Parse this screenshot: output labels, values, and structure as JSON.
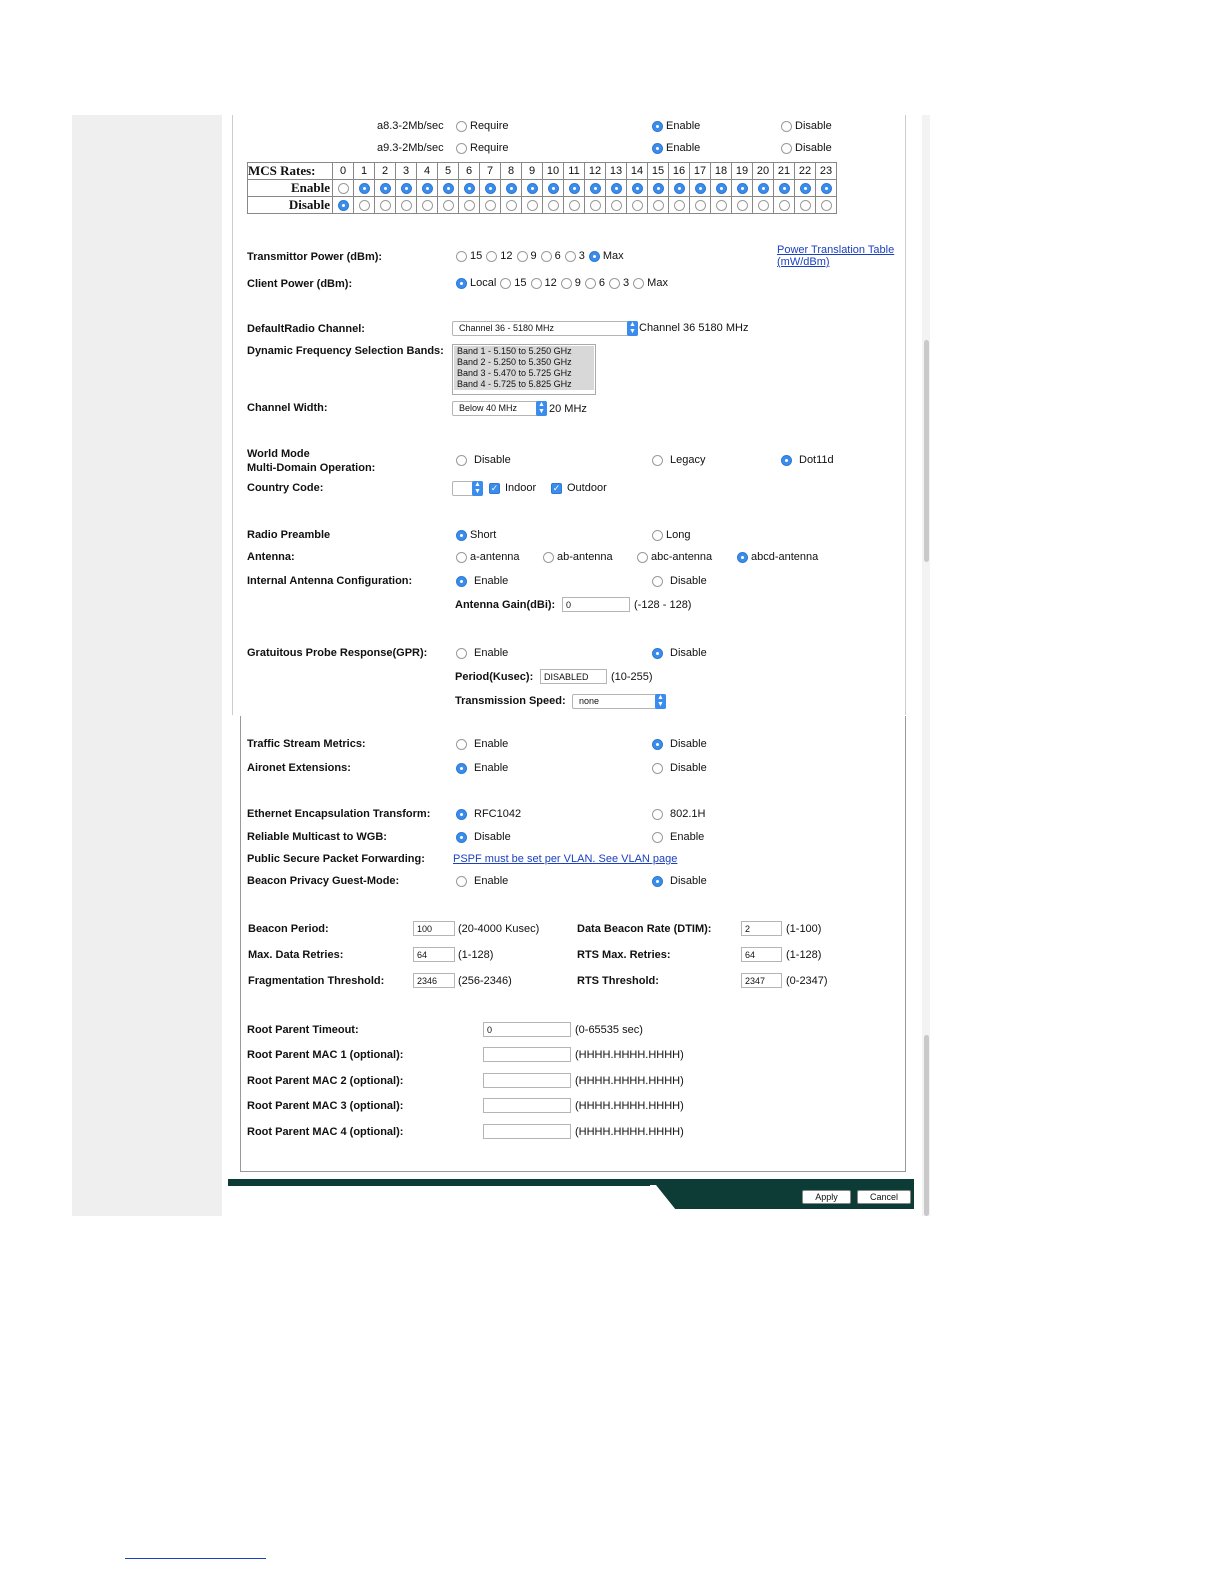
{
  "basic_rates": [
    {
      "rate": "a8.3-2Mb/sec",
      "options": [
        "Require",
        "Enable",
        "Disable"
      ],
      "selected": "Enable"
    },
    {
      "rate": "a9.3-2Mb/sec",
      "options": [
        "Require",
        "Enable",
        "Disable"
      ],
      "selected": "Enable"
    }
  ],
  "mcs": {
    "title": "MCS Rates:",
    "enable_label": "Enable",
    "disable_label": "Disable",
    "indices": [
      "0",
      "1",
      "2",
      "3",
      "4",
      "5",
      "6",
      "7",
      "8",
      "9",
      "10",
      "11",
      "12",
      "13",
      "14",
      "15",
      "16",
      "17",
      "18",
      "19",
      "20",
      "21",
      "22",
      "23"
    ],
    "enabled": [
      false,
      true,
      true,
      true,
      true,
      true,
      true,
      true,
      true,
      true,
      true,
      true,
      true,
      true,
      true,
      true,
      true,
      true,
      true,
      true,
      true,
      true,
      true,
      true
    ]
  },
  "tx_power": {
    "label": "Transmittor Power (dBm):",
    "options": [
      "15",
      "12",
      "9",
      "6",
      "3",
      "Max"
    ],
    "selected": "Max",
    "link_line1": "Power Translation Table",
    "link_line2": "(mW/dBm)"
  },
  "client_power": {
    "label": "Client Power (dBm):",
    "options": [
      "Local",
      "15",
      "12",
      "9",
      "6",
      "3",
      "Max"
    ],
    "selected": "Local"
  },
  "default_channel": {
    "label": "DefaultRadio Channel:",
    "value": "Channel 36 - 5180 MHz",
    "current": "Channel 36 5180 MHz"
  },
  "dfs": {
    "label": "Dynamic Frequency Selection Bands:",
    "bands": [
      "Band 1 - 5.150 to 5.250 GHz",
      "Band 2 - 5.250 to 5.350 GHz",
      "Band 3 - 5.470 to 5.725 GHz",
      "Band 4 - 5.725 to 5.825 GHz"
    ]
  },
  "channel_width": {
    "label": "Channel Width:",
    "value": "Below 40 MHz",
    "current": "20 MHz"
  },
  "world_mode": {
    "label_line1": "World Mode",
    "label_line2": "Multi-Domain Operation:",
    "options": [
      "Disable",
      "Legacy",
      "Dot11d"
    ],
    "selected": "Dot11d"
  },
  "country_code": {
    "label": "Country Code:",
    "indoor": "Indoor",
    "outdoor": "Outdoor"
  },
  "preamble": {
    "label": "Radio Preamble",
    "options": [
      "Short",
      "Long"
    ],
    "selected": "Short"
  },
  "antenna": {
    "label": "Antenna:",
    "options": [
      "a-antenna",
      "ab-antenna",
      "abc-antenna",
      "abcd-antenna"
    ],
    "selected": "abcd-antenna"
  },
  "internal_antenna": {
    "label": "Internal Antenna Configuration:",
    "options": [
      "Enable",
      "Disable"
    ],
    "selected": "Enable",
    "gain_label": "Antenna Gain(dBi):",
    "gain_value": "0",
    "gain_range": "(-128 - 128)"
  },
  "gpr": {
    "label": "Gratuitous Probe Response(GPR):",
    "options": [
      "Enable",
      "Disable"
    ],
    "selected": "Disable",
    "period_label": "Period(Kusec):",
    "period_value": "DISABLED",
    "period_range": "(10-255)",
    "speed_label": "Transmission Speed:",
    "speed_value": "none"
  },
  "traffic_stream": {
    "label": "Traffic Stream Metrics:",
    "options": [
      "Enable",
      "Disable"
    ],
    "selected": "Disable"
  },
  "aironet": {
    "label": "Aironet Extensions:",
    "options": [
      "Enable",
      "Disable"
    ],
    "selected": "Enable"
  },
  "ethernet_encap": {
    "label": "Ethernet Encapsulation Transform:",
    "options": [
      "RFC1042",
      "802.1H"
    ],
    "selected": "RFC1042"
  },
  "reliable_multicast": {
    "label": "Reliable Multicast to WGB:",
    "options": [
      "Disable",
      "Enable"
    ],
    "selected": "Disable"
  },
  "pspf": {
    "label": "Public Secure Packet Forwarding:",
    "link": "PSPF must be set per VLAN. See VLAN page"
  },
  "beacon_privacy": {
    "label": "Beacon Privacy Guest-Mode:",
    "options": [
      "Enable",
      "Disable"
    ],
    "selected": "Disable"
  },
  "timing": {
    "beacon_period": {
      "label": "Beacon Period:",
      "value": "100",
      "range": "(20-4000 Kusec)"
    },
    "dtim": {
      "label": "Data Beacon Rate (DTIM):",
      "value": "2",
      "range": "(1-100)"
    },
    "max_data_retries": {
      "label": "Max. Data Retries:",
      "value": "64",
      "range": "(1-128)"
    },
    "rts_max_retries": {
      "label": "RTS Max. Retries:",
      "value": "64",
      "range": "(1-128)"
    },
    "frag_threshold": {
      "label": "Fragmentation Threshold:",
      "value": "2346",
      "range": "(256-2346)"
    },
    "rts_threshold": {
      "label": "RTS Threshold:",
      "value": "2347",
      "range": "(0-2347)"
    }
  },
  "root_parent": {
    "timeout": {
      "label": "Root Parent Timeout:",
      "value": "0",
      "range": "(0-65535 sec)"
    },
    "macs": [
      {
        "label": "Root Parent MAC 1 (optional):",
        "value": "",
        "format": "(HHHH.HHHH.HHHH)"
      },
      {
        "label": "Root Parent MAC 2 (optional):",
        "value": "",
        "format": "(HHHH.HHHH.HHHH)"
      },
      {
        "label": "Root Parent MAC 3 (optional):",
        "value": "",
        "format": "(HHHH.HHHH.HHHH)"
      },
      {
        "label": "Root Parent MAC 4 (optional):",
        "value": "",
        "format": "(HHHH.HHHH.HHHH)"
      }
    ]
  },
  "footer": {
    "apply": "Apply",
    "cancel": "Cancel"
  },
  "colors": {
    "accent": "#3b8ded",
    "footer_bar": "#0d3b36",
    "link": "#1a3fbf"
  }
}
